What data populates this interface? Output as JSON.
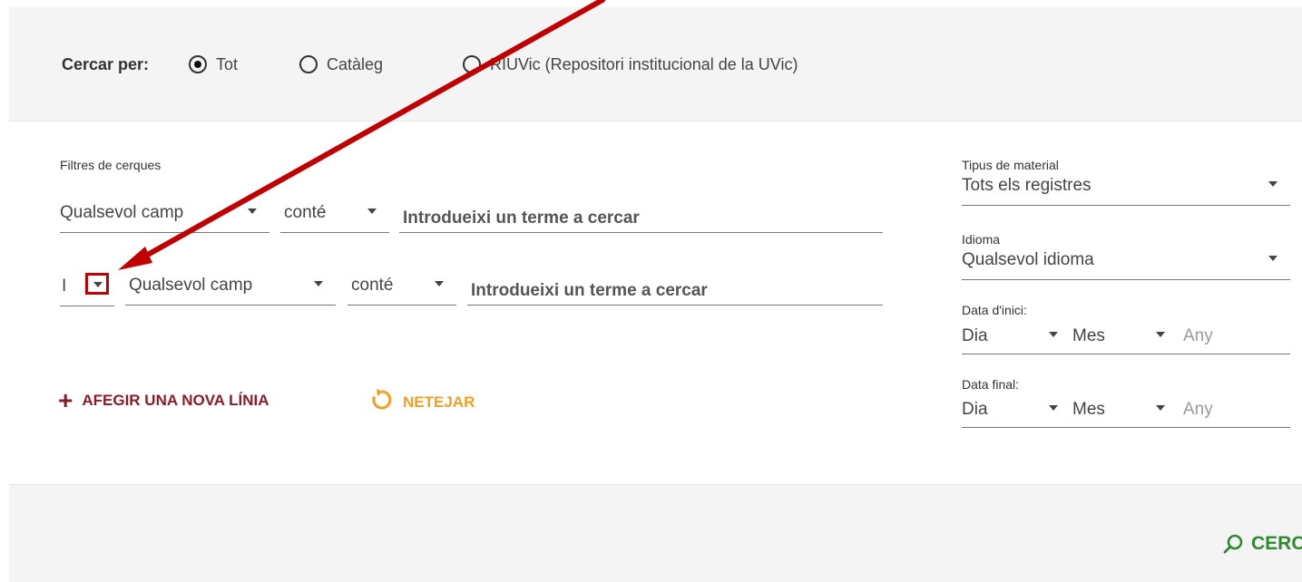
{
  "scope": {
    "label": "Cercar per:",
    "options": [
      {
        "label": "Tot",
        "selected": true
      },
      {
        "label": "Catàleg",
        "selected": false
      },
      {
        "label": "RIUVic (Repositori institucional de la UVic)",
        "selected": false
      }
    ]
  },
  "filters": {
    "heading": "Filtres de cerques",
    "row1": {
      "field": "Qualsevol camp",
      "operator": "conté",
      "placeholder": "Introdueixi un terme a cercar"
    },
    "row2": {
      "boolean": "I",
      "field": "Qualsevol camp",
      "operator": "conté",
      "placeholder": "Introdueixi un terme a cercar"
    }
  },
  "actions": {
    "add_line": "AFEGIR UNA NOVA LÍNIA",
    "clear": "NETEJAR"
  },
  "right": {
    "material_label": "Tipus de material",
    "material_value": "Tots els registres",
    "language_label": "Idioma",
    "language_value": "Qualsevol idioma",
    "start_label": "Data d'inici:",
    "end_label": "Data final:",
    "day": "Dia",
    "month": "Mes",
    "year": "Any"
  },
  "search_button": "CERCAR",
  "colors": {
    "accent_red": "#8b1c2b",
    "accent_orange": "#f0a020",
    "accent_green": "#2e8a2e",
    "annotation_red": "#c00000"
  }
}
